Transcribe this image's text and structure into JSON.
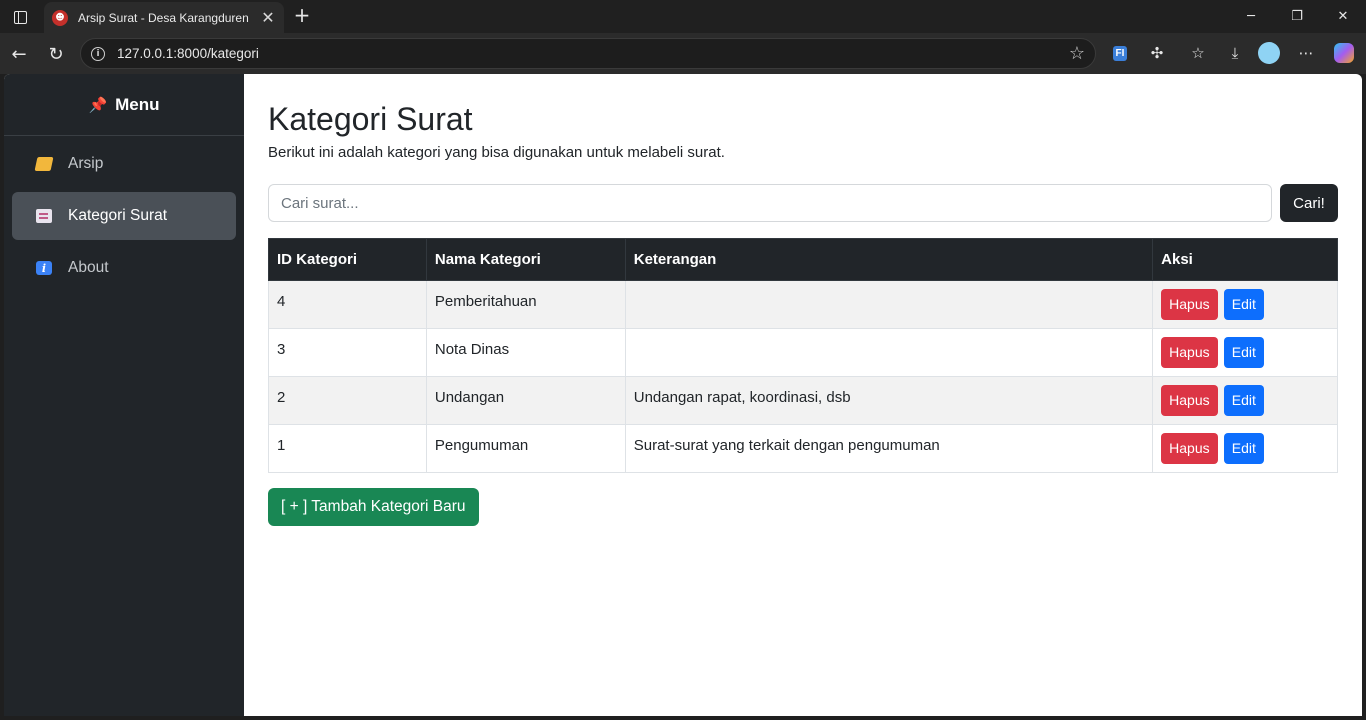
{
  "browser": {
    "tab_title": "Arsip Surat - Desa Karangduren",
    "tab_close": "✕",
    "new_tab": "+",
    "url": "127.0.0.1:8000/kategori",
    "extension_label": "FI"
  },
  "sidebar": {
    "header": "Menu",
    "items": [
      {
        "label": "Arsip",
        "icon": "folder-icon",
        "active": false
      },
      {
        "label": "Kategori Surat",
        "icon": "memo-icon",
        "active": true
      },
      {
        "label": "About",
        "icon": "info-icon",
        "active": false
      }
    ]
  },
  "main": {
    "title": "Kategori Surat",
    "description": "Berikut ini adalah kategori yang bisa digunakan untuk melabeli surat.",
    "search": {
      "placeholder": "Cari surat...",
      "value": "",
      "button": "Cari!"
    },
    "table": {
      "headers": [
        "ID Kategori",
        "Nama Kategori",
        "Keterangan",
        "Aksi"
      ],
      "rows": [
        {
          "id": "4",
          "nama": "Pemberitahuan",
          "keterangan": ""
        },
        {
          "id": "3",
          "nama": "Nota Dinas",
          "keterangan": ""
        },
        {
          "id": "2",
          "nama": "Undangan",
          "keterangan": "Undangan rapat, koordinasi, dsb"
        },
        {
          "id": "1",
          "nama": "Pengumuman",
          "keterangan": "Surat-surat yang terkait dengan pengumuman"
        }
      ],
      "delete_label": "Hapus",
      "edit_label": "Edit"
    },
    "add_button": "[ + ] Tambah Kategori Baru"
  },
  "colors": {
    "sidebar_bg": "#212529",
    "danger": "#dc3545",
    "primary": "#0d6efd",
    "success": "#198754"
  }
}
